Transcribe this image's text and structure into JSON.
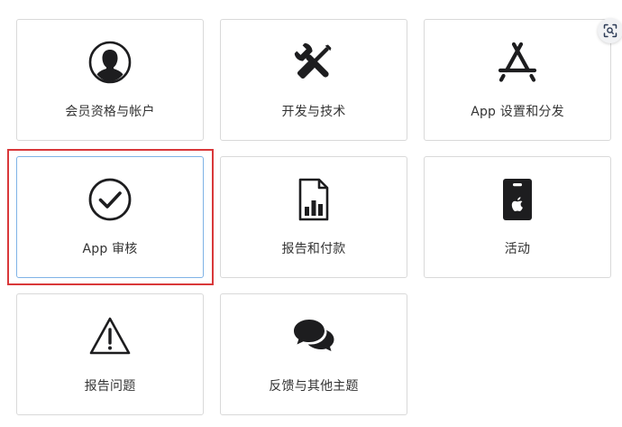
{
  "cards": [
    {
      "label": "会员资格与帐户",
      "icon": "person-circle-icon"
    },
    {
      "label": "开发与技术",
      "icon": "wrench-screwdriver-icon"
    },
    {
      "label": "App 设置和分发",
      "icon": "app-store-icon"
    },
    {
      "label": "App 审核",
      "icon": "checkmark-circle-icon",
      "state": "selected"
    },
    {
      "label": "报告和付款",
      "icon": "report-chart-icon"
    },
    {
      "label": "活动",
      "icon": "event-badge-icon"
    },
    {
      "label": "报告问题",
      "icon": "warning-triangle-icon"
    },
    {
      "label": "反馈与其他主题",
      "icon": "chat-bubbles-icon"
    }
  ],
  "colors": {
    "icon": "#1d1d1f",
    "text": "#333333",
    "card_border": "#d9d9d9",
    "selected_border": "#7fb3e6",
    "highlight": "#d9383a"
  },
  "scan_button_icon": "visual-lookup-icon"
}
